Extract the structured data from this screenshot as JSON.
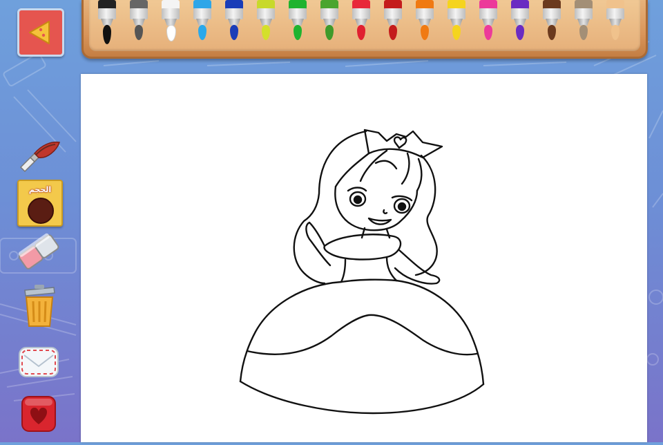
{
  "app": {
    "back_button": {
      "icon": "back-arrow-icon"
    },
    "tools": {
      "brush": {
        "icon": "paintbrush-icon"
      },
      "size": {
        "label": "الحجم",
        "icon": "brush-size-dot-icon",
        "dot_color": "#5a1d13"
      },
      "eraser": {
        "icon": "eraser-icon"
      },
      "trash": {
        "icon": "trash-can-icon"
      },
      "share": {
        "icon": "envelope-icon"
      },
      "favorite": {
        "icon": "heart-icon"
      }
    },
    "palette": [
      {
        "name": "black",
        "cap": "#222222",
        "ink": "#111111"
      },
      {
        "name": "gray",
        "cap": "#666666",
        "ink": "#555555"
      },
      {
        "name": "white",
        "cap": "#f4f4f4",
        "ink": "#ffffff"
      },
      {
        "name": "light-blue",
        "cap": "#2ea6e8",
        "ink": "#2aa8ea"
      },
      {
        "name": "dark-blue",
        "cap": "#1a3db8",
        "ink": "#1a3db8"
      },
      {
        "name": "yellow-green",
        "cap": "#c8d92a",
        "ink": "#d4e02a"
      },
      {
        "name": "green",
        "cap": "#1fb32f",
        "ink": "#1fb32f"
      },
      {
        "name": "dark-green",
        "cap": "#4aa52f",
        "ink": "#3f9a2a"
      },
      {
        "name": "red",
        "cap": "#e8283a",
        "ink": "#e02030"
      },
      {
        "name": "dark-red",
        "cap": "#c41c1c",
        "ink": "#c41c1c"
      },
      {
        "name": "orange",
        "cap": "#f07a12",
        "ink": "#f07a12"
      },
      {
        "name": "yellow",
        "cap": "#f5d41e",
        "ink": "#f5d41e"
      },
      {
        "name": "pink",
        "cap": "#ec3a9a",
        "ink": "#ec3a9a"
      },
      {
        "name": "purple",
        "cap": "#6a2cc2",
        "ink": "#6a2cc2"
      },
      {
        "name": "brown",
        "cap": "#6b3a1e",
        "ink": "#6b3a1e"
      },
      {
        "name": "tan",
        "cap": "#a38f76",
        "ink": "#a38f76"
      },
      {
        "name": "peach",
        "cap": "#f0c28c",
        "ink": "#f0c28c"
      }
    ],
    "selected_color": "black",
    "canvas": {
      "drawing": "princess-outline"
    }
  }
}
